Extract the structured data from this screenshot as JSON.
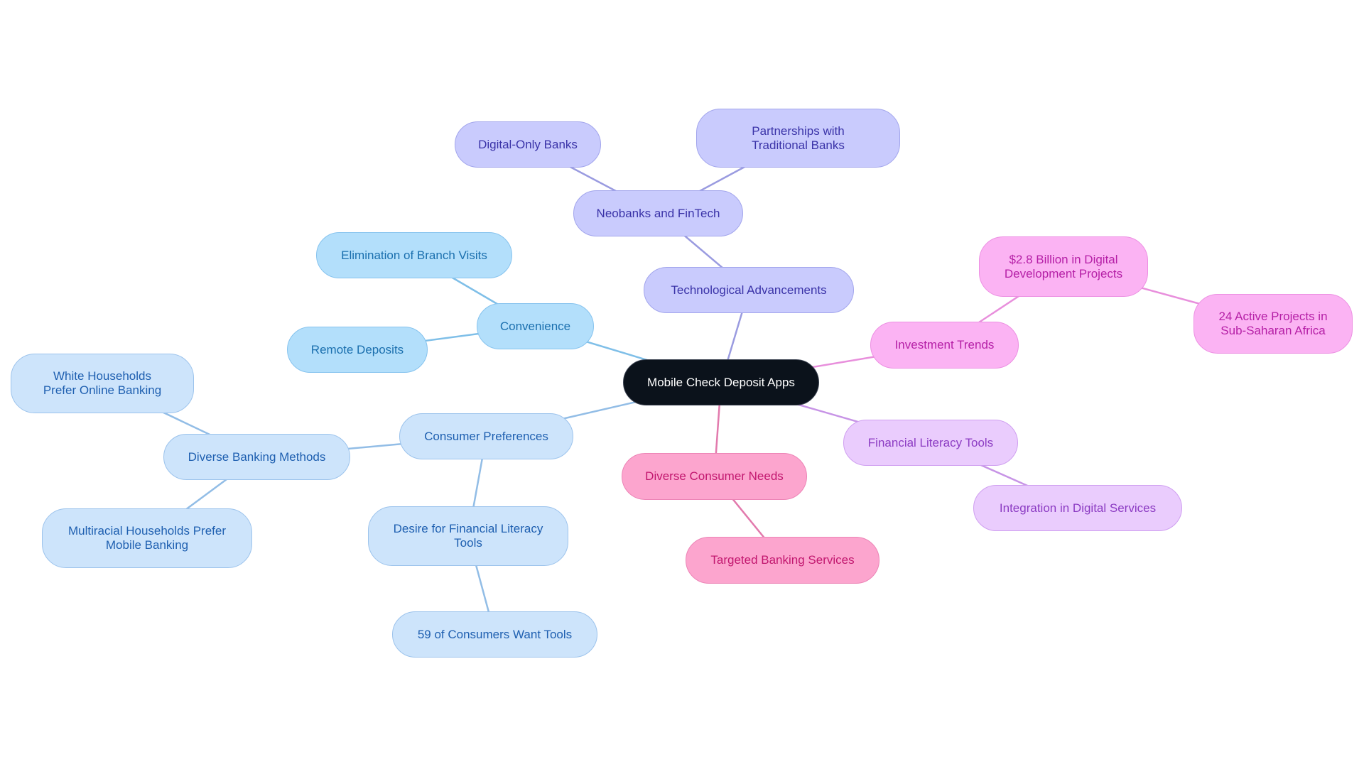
{
  "diagram": {
    "type": "mindmap",
    "root": {
      "id": "root",
      "label": "Mobile Check Deposit Apps"
    },
    "branch_colors": {
      "sky": "#b3dffb",
      "blue": "#cde4fb",
      "indigo": "#c9cbfd",
      "magenta": "#fbb3f3",
      "violet": "#eaccfd",
      "pink": "#fca5ce",
      "root": "#0b121b"
    },
    "edge_colors": {
      "sky": "#7fbfe8",
      "blue": "#92bde6",
      "indigo": "#9a9be0",
      "magenta": "#e88fdc",
      "violet": "#c794e6",
      "pink": "#e27aad"
    },
    "nodes": [
      {
        "id": "tech",
        "parent": "root",
        "label": "Technological Advancements",
        "color": "indigo"
      },
      {
        "id": "neo",
        "parent": "tech",
        "label": "Neobanks and FinTech",
        "color": "indigo"
      },
      {
        "id": "digital",
        "parent": "neo",
        "label": "Digital-Only Banks",
        "color": "indigo"
      },
      {
        "id": "partner",
        "parent": "neo",
        "label": "Partnerships with Traditional Banks",
        "color": "indigo"
      },
      {
        "id": "conv",
        "parent": "root",
        "label": "Convenience",
        "color": "sky"
      },
      {
        "id": "elim",
        "parent": "conv",
        "label": "Elimination of Branch Visits",
        "color": "sky"
      },
      {
        "id": "remote",
        "parent": "conv",
        "label": "Remote Deposits",
        "color": "sky"
      },
      {
        "id": "pref",
        "parent": "root",
        "label": "Consumer Preferences",
        "color": "blue"
      },
      {
        "id": "methods",
        "parent": "pref",
        "label": "Diverse Banking Methods",
        "color": "blue"
      },
      {
        "id": "white",
        "parent": "methods",
        "label": "White Households Prefer Online Banking",
        "color": "blue"
      },
      {
        "id": "multi",
        "parent": "methods",
        "label": "Multiracial Households Prefer Mobile Banking",
        "color": "blue"
      },
      {
        "id": "desire",
        "parent": "pref",
        "label": "Desire for Financial Literacy Tools",
        "color": "blue"
      },
      {
        "id": "fiftynine",
        "parent": "desire",
        "label": "59 of Consumers Want Tools",
        "color": "blue"
      },
      {
        "id": "invest",
        "parent": "root",
        "label": "Investment Trends",
        "color": "magenta"
      },
      {
        "id": "billion",
        "parent": "invest",
        "label": "$2.8 Billion in Digital Development Projects",
        "color": "magenta"
      },
      {
        "id": "africa",
        "parent": "billion",
        "label": "24 Active Projects in Sub-Saharan Africa",
        "color": "magenta"
      },
      {
        "id": "fintools",
        "parent": "root",
        "label": "Financial Literacy Tools",
        "color": "violet"
      },
      {
        "id": "integr",
        "parent": "fintools",
        "label": "Integration in Digital Services",
        "color": "violet"
      },
      {
        "id": "needs",
        "parent": "root",
        "label": "Diverse Consumer Needs",
        "color": "pink"
      },
      {
        "id": "targeted",
        "parent": "needs",
        "label": "Targeted Banking Services",
        "color": "pink"
      }
    ]
  }
}
